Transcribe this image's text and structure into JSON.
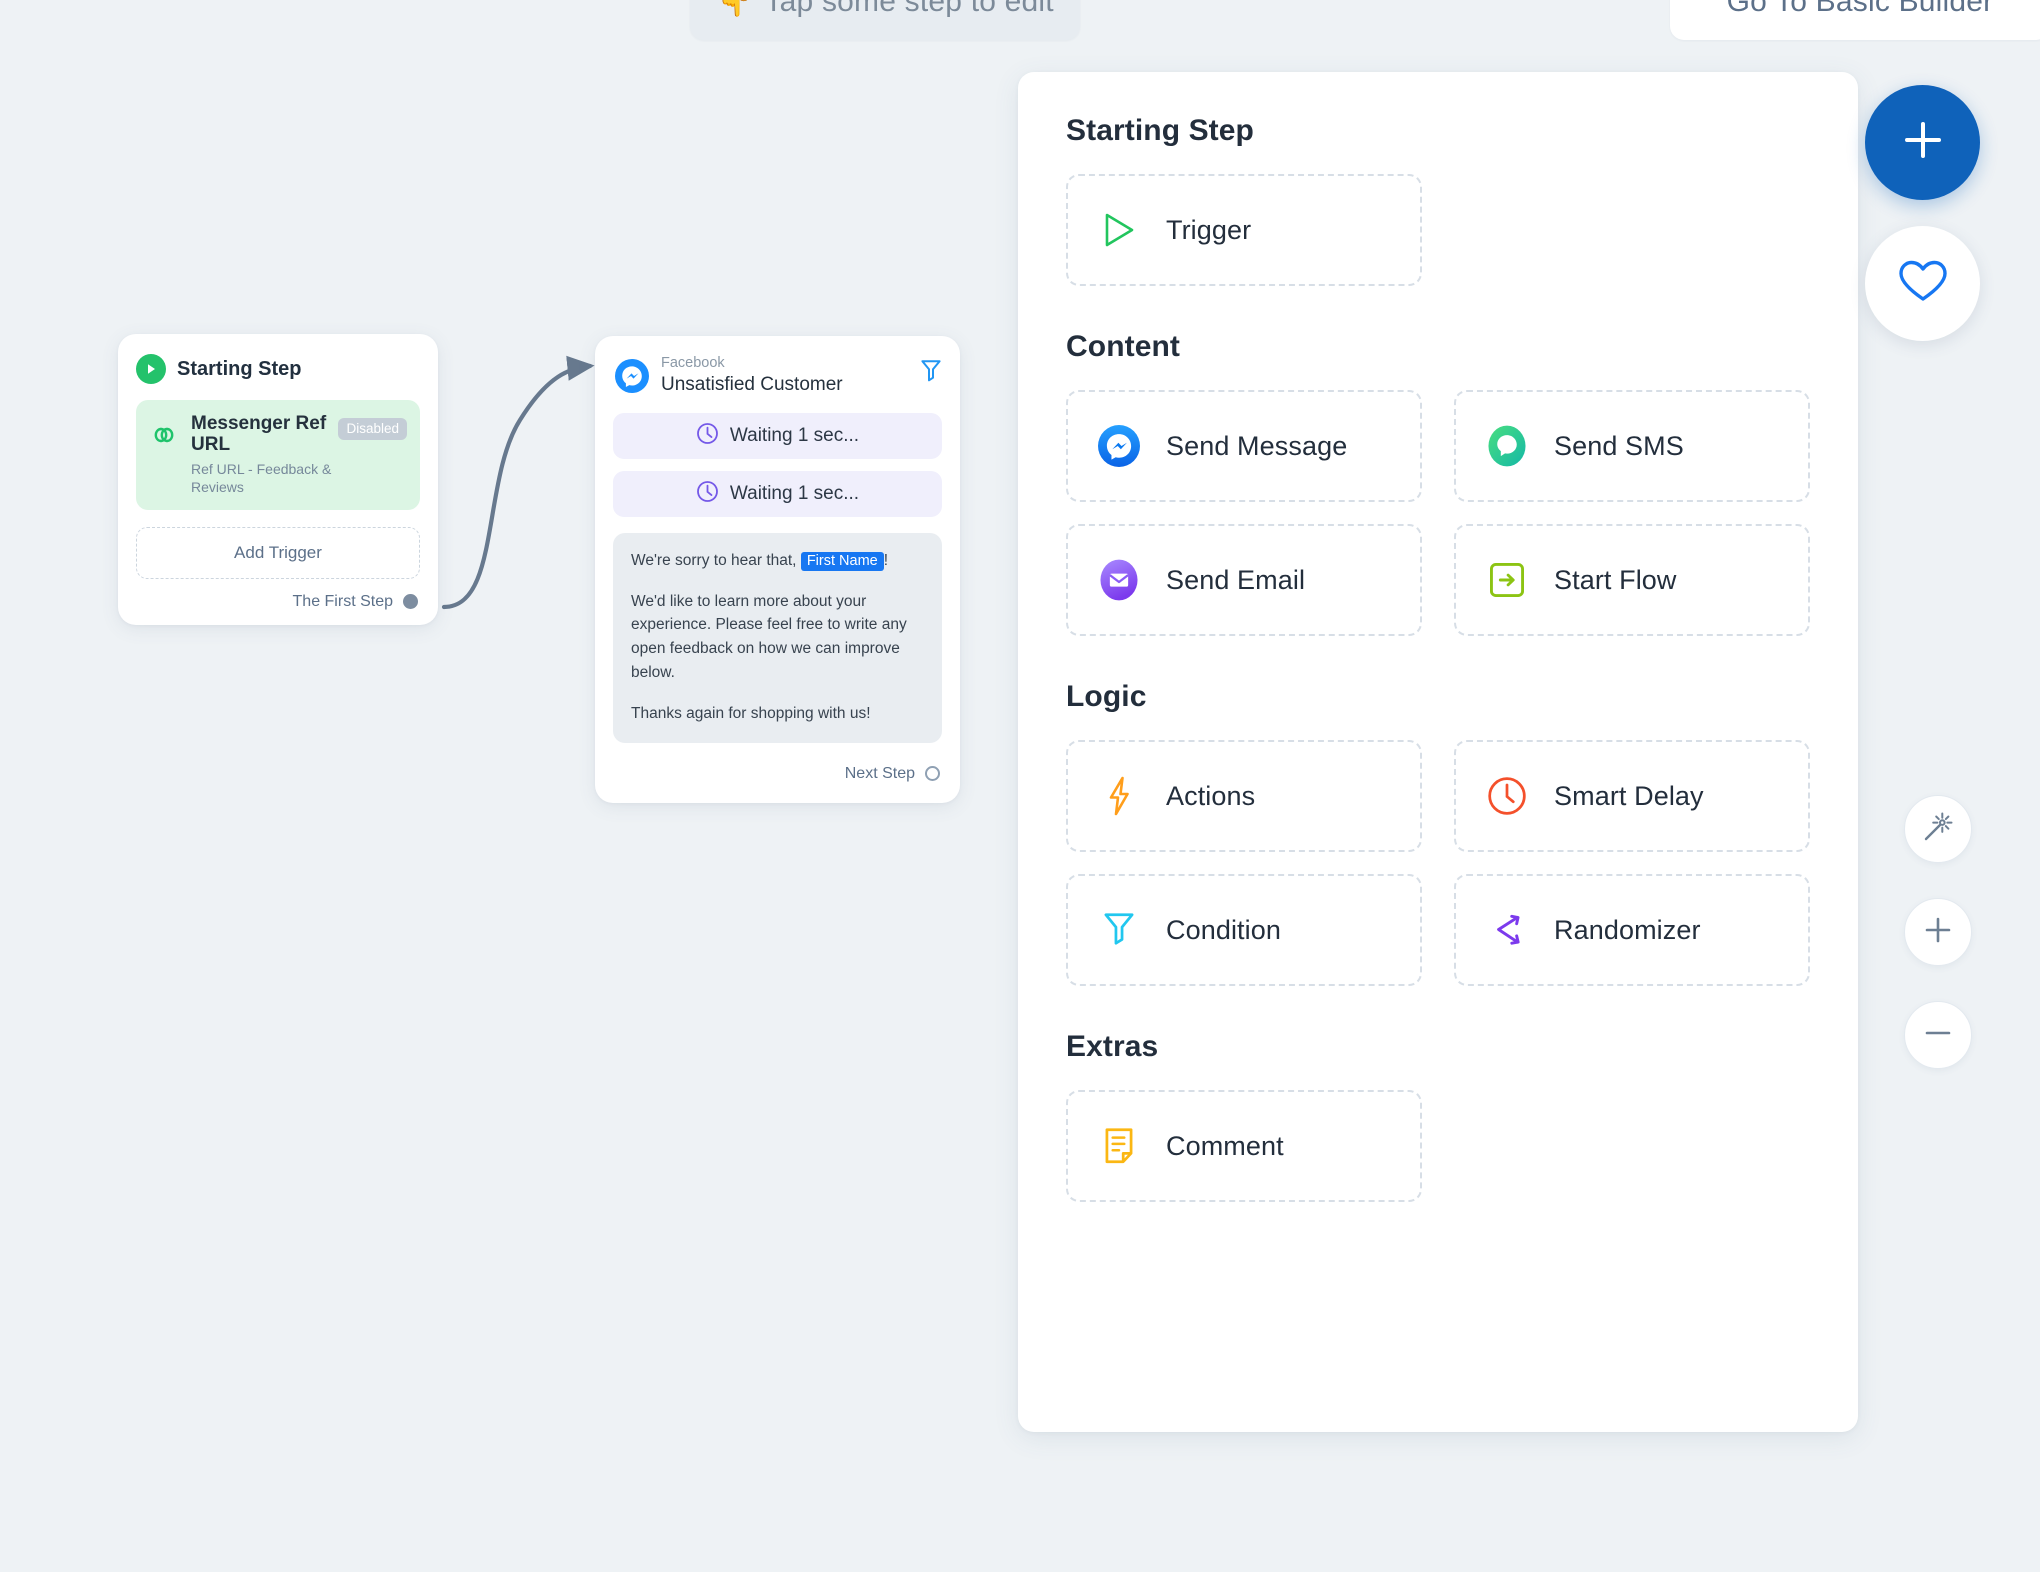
{
  "toolbar": {
    "tap_hint_emoji": "👇",
    "tap_hint": "Tap some step to edit",
    "basic_builder": "Go To Basic Builder"
  },
  "canvas": {
    "start_node": {
      "header": "Starting Step",
      "trigger": {
        "title": "Messenger Ref URL",
        "subtitle": "Ref URL - Feedback & Reviews",
        "badge": "Disabled"
      },
      "add_trigger": "Add Trigger",
      "out_port_label": "The First Step"
    },
    "message_node": {
      "platform": "Facebook",
      "title": "Unsatisfied Customer",
      "steps": [
        {
          "label": "Waiting 1 sec..."
        },
        {
          "label": "Waiting 1 sec..."
        }
      ],
      "bubble": {
        "line1_prefix": "We're sorry to hear that,",
        "line1_token": "First Name",
        "line1_suffix": "!",
        "line2": "We'd like to learn more about your experience. Please feel free to write any open feedback on how we can improve below.",
        "line3": "Thanks again for shopping with us!"
      },
      "out_port_label": "Next Step"
    }
  },
  "panel": {
    "sections": [
      {
        "title": "Starting Step",
        "items": [
          {
            "label": "Trigger",
            "icon": "play-triangle-icon",
            "color": "#22c55e"
          }
        ]
      },
      {
        "title": "Content",
        "items": [
          {
            "label": "Send Message",
            "icon": "messenger-icon",
            "color": "#1b8fff"
          },
          {
            "label": "Send SMS",
            "icon": "sms-bubble-icon",
            "color": "#22c98d"
          },
          {
            "label": "Send Email",
            "icon": "email-envelope-icon",
            "color": "#8b5cf6"
          },
          {
            "label": "Start Flow",
            "icon": "arrow-into-box-icon",
            "color": "#8cc413"
          }
        ]
      },
      {
        "title": "Logic",
        "items": [
          {
            "label": "Actions",
            "icon": "lightning-bolt-icon",
            "color": "#ff9e1b"
          },
          {
            "label": "Smart Delay",
            "icon": "clock-icon",
            "color": "#f4502b"
          },
          {
            "label": "Condition",
            "icon": "funnel-icon",
            "color": "#21c7ef"
          },
          {
            "label": "Randomizer",
            "icon": "randomizer-icon",
            "color": "#7c3aed"
          }
        ]
      },
      {
        "title": "Extras",
        "items": [
          {
            "label": "Comment",
            "icon": "note-icon",
            "color": "#fbb713"
          }
        ]
      }
    ]
  },
  "controls": {
    "add": "add-plus-icon",
    "favorite": "heart-icon",
    "magic": "magic-wand-icon",
    "zoom_in": "plus-icon",
    "zoom_out": "minus-icon"
  },
  "colors": {
    "background": "#eef2f5",
    "accent": "#0f62ba",
    "green": "#24c26b",
    "purple": "#6d5ce7",
    "token_blue": "#1777f2"
  }
}
